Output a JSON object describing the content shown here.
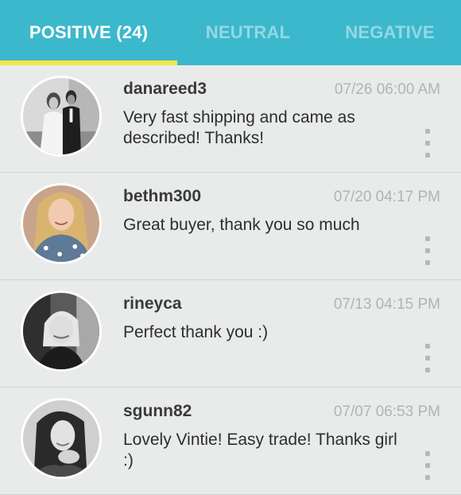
{
  "colors": {
    "accent": "#3cb8cc",
    "indicator": "#f2e64b"
  },
  "tabs": [
    {
      "label": "POSITIVE (24)",
      "active": true
    },
    {
      "label": "NEUTRAL",
      "active": false
    },
    {
      "label": "NEGATIVE",
      "active": false
    }
  ],
  "reviews": [
    {
      "username": "danareed3",
      "timestamp": "07/26 06:00 AM",
      "comment": "Very fast shipping and came as described! Thanks!",
      "avatar_icon": "couple-photo"
    },
    {
      "username": "bethm300",
      "timestamp": "07/20 04:17 PM",
      "comment": "Great buyer, thank you so much",
      "avatar_icon": "woman-blonde-photo"
    },
    {
      "username": "rineyca",
      "timestamp": "07/13 04:15 PM",
      "comment": "Perfect thank you :)",
      "avatar_icon": "woman-bw-photo"
    },
    {
      "username": "sgunn82",
      "timestamp": "07/07 06:53 PM",
      "comment": "Lovely Vintie! Easy trade! Thanks girl :)",
      "avatar_icon": "woman-bw-photo"
    }
  ]
}
